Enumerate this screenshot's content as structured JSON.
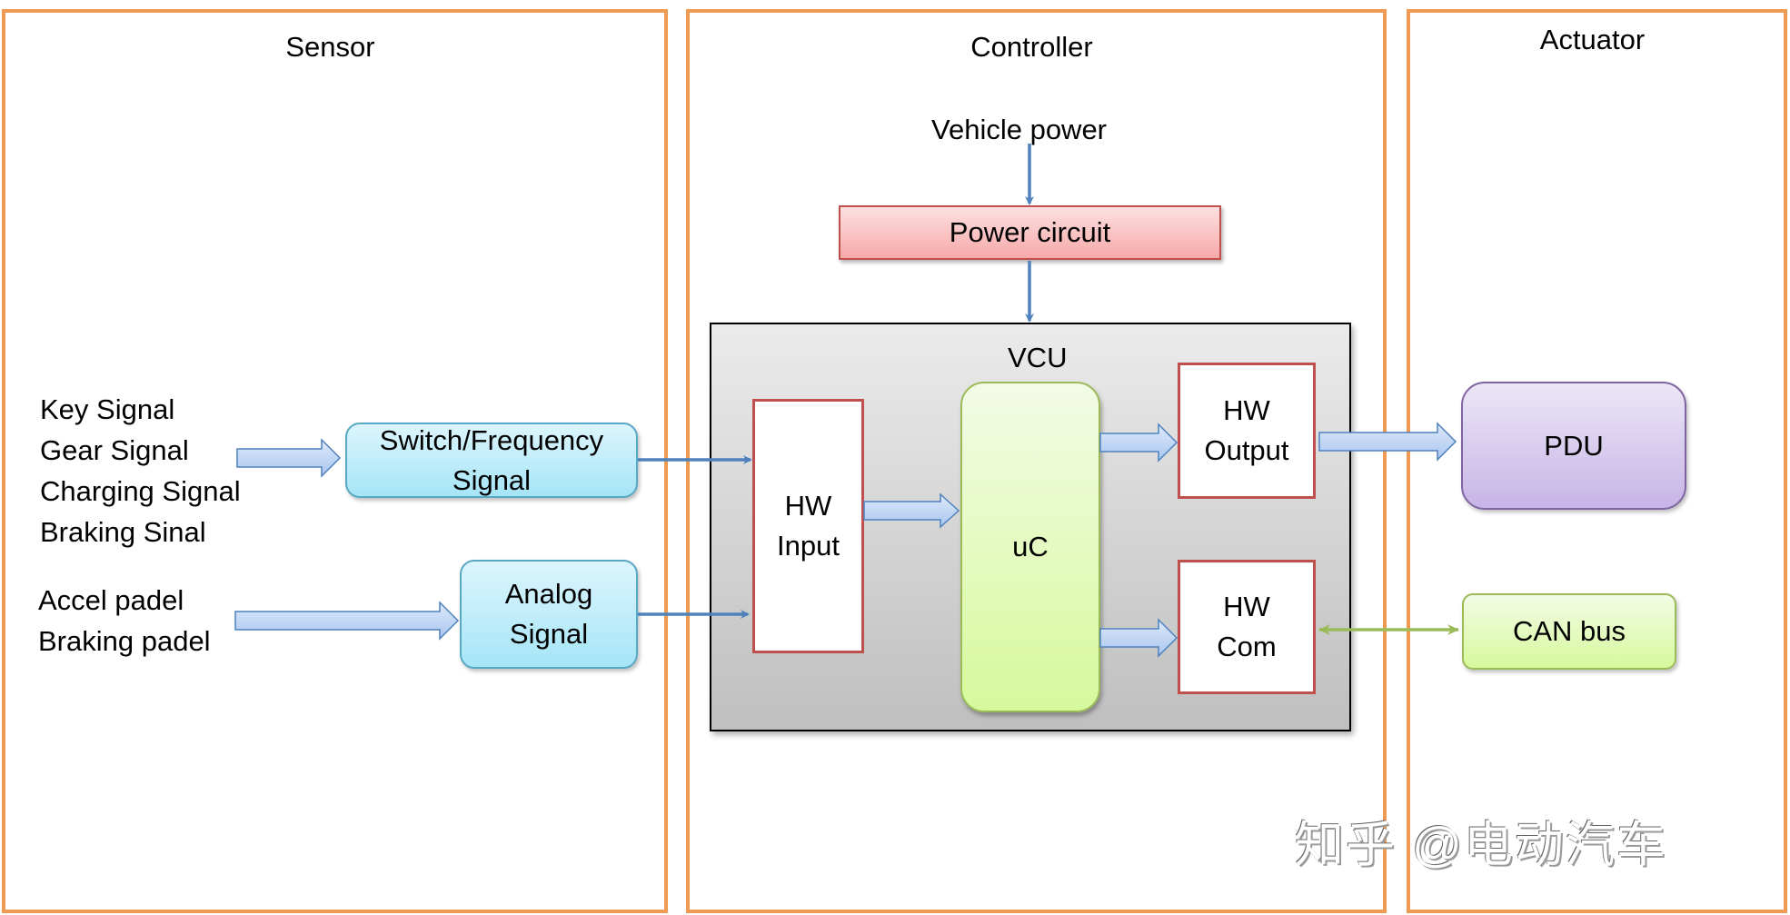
{
  "panels": {
    "sensor": {
      "title": "Sensor"
    },
    "controller": {
      "title": "Controller"
    },
    "actuator": {
      "title": "Actuator"
    }
  },
  "sensor": {
    "digital_inputs": [
      "Key Signal",
      "Gear Signal",
      "Charging Signal",
      "Braking Sinal"
    ],
    "analog_inputs": [
      "Accel padel",
      "Braking padel"
    ],
    "switch_frequency_box": {
      "line1": "Switch/Frequency",
      "line2": "Signal"
    },
    "analog_box": {
      "line1": "Analog",
      "line2": "Signal"
    }
  },
  "controller": {
    "vehicle_power": "Vehicle power",
    "power_circuit": "Power circuit",
    "vcu": {
      "title": "VCU",
      "hw_input": {
        "line1": "HW",
        "line2": "Input"
      },
      "uc": "uC",
      "hw_output": {
        "line1": "HW",
        "line2": "Output"
      },
      "hw_com": {
        "line1": "HW",
        "line2": "Com"
      }
    }
  },
  "actuator": {
    "pdu": "PDU",
    "can_bus": "CAN bus"
  },
  "connections": [
    {
      "from": "digital-inputs",
      "to": "switch-frequency-box",
      "style": "block-arrow"
    },
    {
      "from": "analog-inputs",
      "to": "analog-box",
      "style": "block-arrow"
    },
    {
      "from": "switch-frequency-box",
      "to": "hw-input",
      "style": "line-arrow"
    },
    {
      "from": "analog-box",
      "to": "hw-input",
      "style": "line-arrow"
    },
    {
      "from": "vehicle-power",
      "to": "power-circuit",
      "style": "line-arrow"
    },
    {
      "from": "power-circuit",
      "to": "vcu",
      "style": "line-arrow"
    },
    {
      "from": "hw-input",
      "to": "uc",
      "style": "block-arrow"
    },
    {
      "from": "uc",
      "to": "hw-output",
      "style": "block-arrow"
    },
    {
      "from": "uc",
      "to": "hw-com",
      "style": "block-arrow"
    },
    {
      "from": "hw-output",
      "to": "pdu",
      "style": "block-arrow"
    },
    {
      "from": "hw-com",
      "to": "can-bus",
      "style": "bidirectional"
    }
  ],
  "colors": {
    "panel_border": "#ee9a52",
    "line_arrow": "#4f81bd",
    "block_arrow_fill": "#c6dbf7",
    "can_arrow": "#9bbb59",
    "red_border": "#c0504d"
  },
  "watermark": "知乎 @电动汽车"
}
